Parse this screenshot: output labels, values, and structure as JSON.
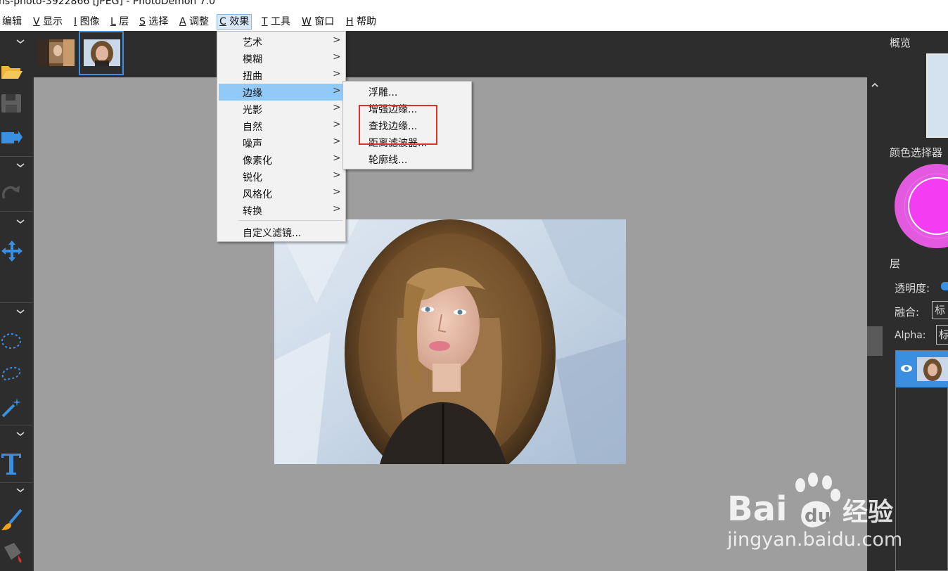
{
  "window": {
    "title": "ns-photo-3922866 [JPEG]  -  PhotoDemon 7.0"
  },
  "menubar": [
    {
      "key": "",
      "label": "编辑"
    },
    {
      "key": "V",
      "label": "显示"
    },
    {
      "key": "I",
      "label": "图像"
    },
    {
      "key": "L",
      "label": "层"
    },
    {
      "key": "S",
      "label": "选择"
    },
    {
      "key": "A",
      "label": "调整"
    },
    {
      "key": "C",
      "label": "效果"
    },
    {
      "key": "T",
      "label": "工具"
    },
    {
      "key": "W",
      "label": "窗口"
    },
    {
      "key": "H",
      "label": "帮助"
    }
  ],
  "effects_menu": {
    "items": [
      {
        "label": "艺术",
        "arrow": ">"
      },
      {
        "label": "模糊",
        "arrow": ">"
      },
      {
        "label": "扭曲",
        "arrow": ">"
      },
      {
        "label": "边缘",
        "arrow": ">"
      },
      {
        "label": "光影",
        "arrow": ">"
      },
      {
        "label": "自然",
        "arrow": ">"
      },
      {
        "label": "噪声",
        "arrow": ">"
      },
      {
        "label": "像素化",
        "arrow": ">"
      },
      {
        "label": "锐化",
        "arrow": ">"
      },
      {
        "label": "风格化",
        "arrow": ">"
      },
      {
        "label": "转换",
        "arrow": ">"
      }
    ],
    "custom_filter": "自定义滤镜..."
  },
  "edges_submenu": {
    "items": [
      {
        "label": "浮雕..."
      },
      {
        "label": "增强边缘..."
      },
      {
        "label": "查找边缘..."
      },
      {
        "label": "距离滤波器..."
      },
      {
        "label": "轮廓线..."
      }
    ]
  },
  "right_panel": {
    "overview_title": "概览",
    "color_picker_title": "颜色选择器",
    "layers_title": "层",
    "opacity_label": "透明度:",
    "blend_label": "融合:",
    "blend_value": "标",
    "alpha_label": "Alpha:",
    "alpha_value": "标"
  },
  "colors": {
    "accent": "#3a8fe0",
    "menu_highlight": "#91c9f7",
    "picker_magenta": "#f43cf2",
    "annotation_red": "#e0302c"
  },
  "watermark": {
    "logo": "Bai du 经验",
    "url": "jingyan.baidu.com"
  }
}
